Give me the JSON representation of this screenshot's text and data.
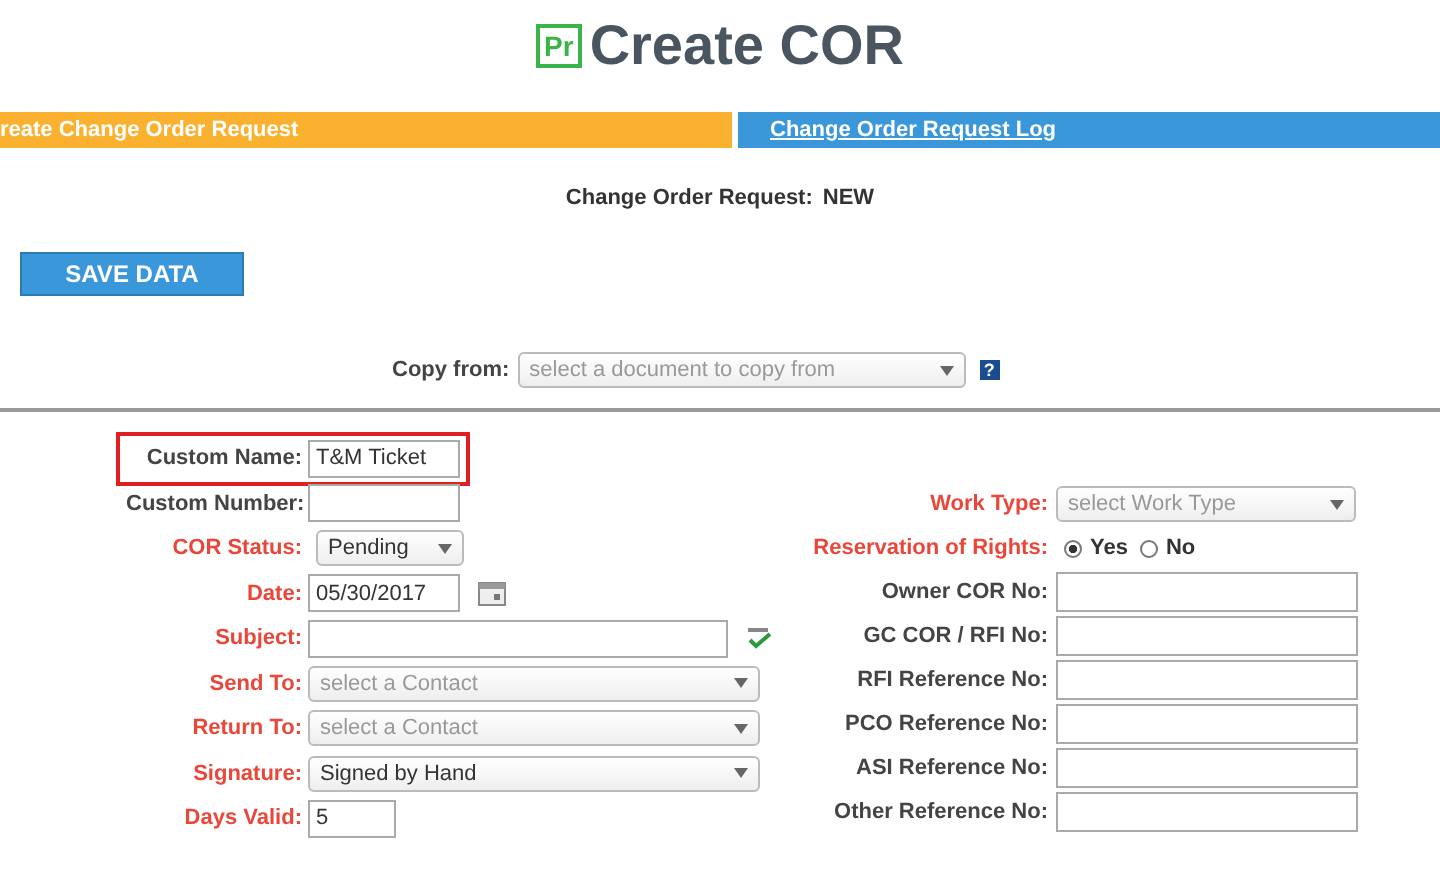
{
  "header": {
    "logo": "Pr",
    "title": "Create COR"
  },
  "tabs": [
    {
      "label": "reate Change Order Request",
      "selected": true
    },
    {
      "label": "Change Order Request Log",
      "selected": false
    }
  ],
  "status": {
    "label": "Change Order Request:",
    "value": "NEW"
  },
  "save_button": "SAVE DATA",
  "copy_from": {
    "label": "Copy from:",
    "placeholder": "select a document to copy from",
    "help": "?"
  },
  "left_fields": [
    {
      "label": "Custom Name:",
      "kind": "short_input",
      "value": "T&M Ticket",
      "required": false,
      "highlighted": true
    },
    {
      "label": "Custom Number:",
      "kind": "short_input",
      "required": false,
      "highlighted": false
    },
    {
      "label": "COR Status:",
      "kind": "short_select",
      "value": "Pending",
      "required": true,
      "highlighted": false
    },
    {
      "label": "Date:",
      "kind": "date",
      "value": "05/30/2017",
      "required": true,
      "highlighted": false
    },
    {
      "label": "Subject:",
      "kind": "spell_input",
      "required": true,
      "highlighted": false
    },
    {
      "label": "Send To:",
      "kind": "long_select",
      "placeholder": "select a Contact",
      "required": true,
      "highlighted": false
    },
    {
      "label": "Return To:",
      "kind": "long_select",
      "placeholder": "select a Contact",
      "required": true,
      "highlighted": false
    },
    {
      "label": "Signature:",
      "kind": "long_select",
      "value": "Signed by Hand",
      "required": true,
      "highlighted": false
    },
    {
      "label": "Days Valid:",
      "kind": "tiny_input",
      "value": "5",
      "required": true,
      "highlighted": false
    }
  ],
  "right_fields": [
    {
      "label": "Work Type:",
      "kind": "select",
      "placeholder": "select Work Type",
      "required": true
    },
    {
      "label": "Reservation of Rights:",
      "kind": "radio",
      "required": true,
      "options": [
        {
          "label": "Yes",
          "selected": true
        },
        {
          "label": "No",
          "selected": false
        }
      ]
    },
    {
      "label": "Owner COR No:",
      "kind": "input",
      "required": false
    },
    {
      "label": "GC COR / RFI No:",
      "kind": "input",
      "required": false
    },
    {
      "label": "RFI Reference No:",
      "kind": "input",
      "required": false
    },
    {
      "label": "PCO Reference No:",
      "kind": "input",
      "required": false
    },
    {
      "label": "ASI Reference No:",
      "kind": "input",
      "required": false
    },
    {
      "label": "Other Reference No:",
      "kind": "input",
      "required": false
    }
  ]
}
